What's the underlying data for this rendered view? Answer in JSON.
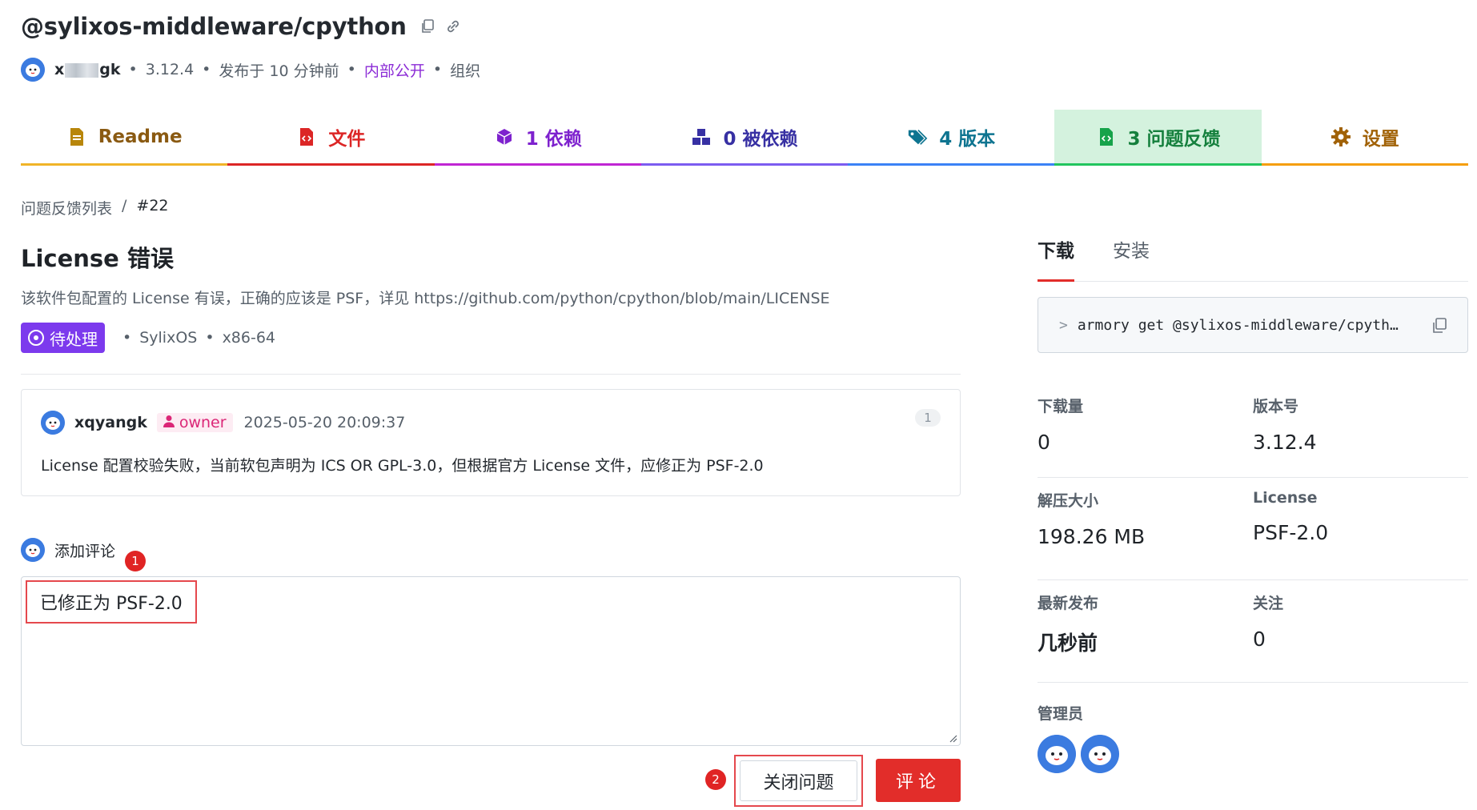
{
  "header": {
    "package_name": "@sylixos-middleware/cpython",
    "author_prefix": "x",
    "author_suffix": "gk",
    "version": "3.12.4",
    "published": "发布于 10 分钟前",
    "visibility": "内部公开",
    "owner_type": "组织"
  },
  "tabs": [
    {
      "label": "Readme",
      "icon": "readme-icon",
      "color": "#b45309"
    },
    {
      "label": "文件",
      "icon": "file-code-icon",
      "color": "#dc2626"
    },
    {
      "label": "1 依赖",
      "icon": "box-icon",
      "color": "#7e22ce"
    },
    {
      "label": "0 被依赖",
      "icon": "boxes-icon",
      "color": "#4338ca"
    },
    {
      "label": "4 版本",
      "icon": "tags-icon",
      "color": "#0e7490"
    },
    {
      "label": "3 问题反馈",
      "icon": "file-code-green-icon",
      "color": "#15803d"
    },
    {
      "label": "设置",
      "icon": "gear-icon",
      "color": "#a16207"
    }
  ],
  "breadcrumb": {
    "parent": "问题反馈列表",
    "separator": "/",
    "current": "#22"
  },
  "issue": {
    "title": "License 错误",
    "description": "该软件包配置的 License 有误，正确的应该是 PSF，详见 https://github.com/python/cpython/blob/main/LICENSE",
    "status": "待处理",
    "os": "SylixOS",
    "arch": "x86-64"
  },
  "comment": {
    "author": "xqyangk",
    "role": "owner",
    "time": "2025-05-20 20:09:37",
    "count": "1",
    "body": "License 配置校验失败，当前软包声明为 ICS OR GPL-3.0，但根据官方 License 文件，应修正为 PSF-2.0"
  },
  "add_comment": {
    "label": "添加评论",
    "text": "已修正为 PSF-2.0",
    "marker1": "1",
    "marker2": "2",
    "close_button": "关闭问题",
    "submit_button": "评论"
  },
  "sidebar": {
    "tabs": [
      "下载",
      "安装"
    ],
    "command_prompt": ">",
    "command": "armory get @sylixos-middleware/cpyth…",
    "stats": [
      {
        "label": "下载量",
        "value": "0"
      },
      {
        "label": "版本号",
        "value": "3.12.4"
      },
      {
        "label": "解压大小",
        "value": "198.26 MB"
      },
      {
        "label": "License",
        "value": "PSF-2.0"
      },
      {
        "label": "最新发布",
        "value": "几秒前"
      },
      {
        "label": "关注",
        "value": "0"
      }
    ],
    "admins_label": "管理员"
  },
  "colors": {
    "accent_red": "#e22d2a",
    "status_purple": "#7c3aed",
    "owner_pink": "#db2777",
    "visibility_purple": "#8b2bd6",
    "active_tab_bg": "#d4f2de"
  }
}
